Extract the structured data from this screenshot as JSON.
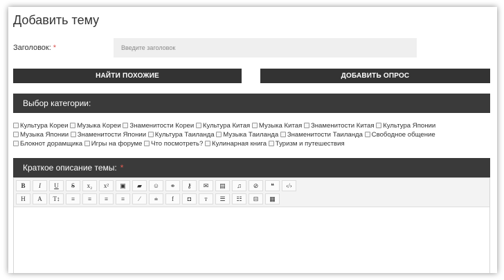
{
  "page": {
    "title": "Добавить тему"
  },
  "title_field": {
    "label": "Заголовок:",
    "required_mark": "*",
    "placeholder": "Введите заголовок"
  },
  "buttons": {
    "find_similar": "НАЙТИ ПОХОЖИЕ",
    "add_poll": "ДОБАВИТЬ ОПРОС"
  },
  "category_section": {
    "header": "Выбор категории:",
    "categories": [
      "Культура Кореи",
      "Музыка Кореи",
      "Знаменитости Кореи",
      "Культура Китая",
      "Музыка Китая",
      "Знаменитости Китая",
      "Культура Японии",
      "Музыка Японии",
      "Знаменитости Японии",
      "Культура Таиланда",
      "Музыка Таиланда",
      "Знаменитости Таиланда",
      "Свободное общение",
      "Блокнот дорамщика",
      "Игры на форуме",
      "Что посмотреть?",
      "Кулинарная книга",
      "Туризм и путешествия"
    ]
  },
  "description_section": {
    "header": "Краткое описание темы:",
    "required_mark": "*"
  },
  "toolbar": {
    "row1": [
      {
        "name": "bold-button",
        "glyph": "B"
      },
      {
        "name": "italic-button",
        "glyph": "I"
      },
      {
        "name": "underline-button",
        "glyph": "U"
      },
      {
        "name": "strike-button",
        "glyph": "S"
      },
      {
        "name": "subscript-button",
        "glyph": "x₂"
      },
      {
        "name": "superscript-button",
        "glyph": "x²"
      },
      {
        "name": "image-button",
        "glyph": "▣"
      },
      {
        "name": "folder-button",
        "glyph": "▰"
      },
      {
        "name": "emoji-button",
        "glyph": "☺"
      },
      {
        "name": "link-button",
        "glyph": "⚭"
      },
      {
        "name": "key-button",
        "glyph": "⚷"
      },
      {
        "name": "email-button",
        "glyph": "✉"
      },
      {
        "name": "video-button",
        "glyph": "▤"
      },
      {
        "name": "music-button",
        "glyph": "♫"
      },
      {
        "name": "hidden-button",
        "glyph": "⊘"
      },
      {
        "name": "quote-button",
        "glyph": "❝"
      },
      {
        "name": "code-button",
        "glyph": "‹/›"
      }
    ],
    "row2": [
      {
        "name": "heading-button",
        "glyph": "H"
      },
      {
        "name": "font-button",
        "glyph": "A"
      },
      {
        "name": "font-size-button",
        "glyph": "T↕"
      },
      {
        "name": "align-left-button",
        "glyph": "≡"
      },
      {
        "name": "align-center-button",
        "glyph": "≡"
      },
      {
        "name": "align-right-button",
        "glyph": "≡"
      },
      {
        "name": "justify-button",
        "glyph": "≡"
      },
      {
        "name": "color-button",
        "glyph": "⁄"
      },
      {
        "name": "indent-button",
        "glyph": "⩧"
      },
      {
        "name": "facebook-button",
        "glyph": "f"
      },
      {
        "name": "instagram-button",
        "glyph": "◘"
      },
      {
        "name": "text-button",
        "glyph": "ᴛ"
      },
      {
        "name": "bullet-list-button",
        "glyph": "☰"
      },
      {
        "name": "numbered-list-button",
        "glyph": "☷"
      },
      {
        "name": "spoiler-button",
        "glyph": "⊟"
      },
      {
        "name": "table-button",
        "glyph": "▦"
      }
    ]
  },
  "colors": {
    "bar_bg": "#3a3a3a",
    "button_bg": "#333333",
    "required": "#d9534f",
    "input_bg": "#efefef"
  }
}
